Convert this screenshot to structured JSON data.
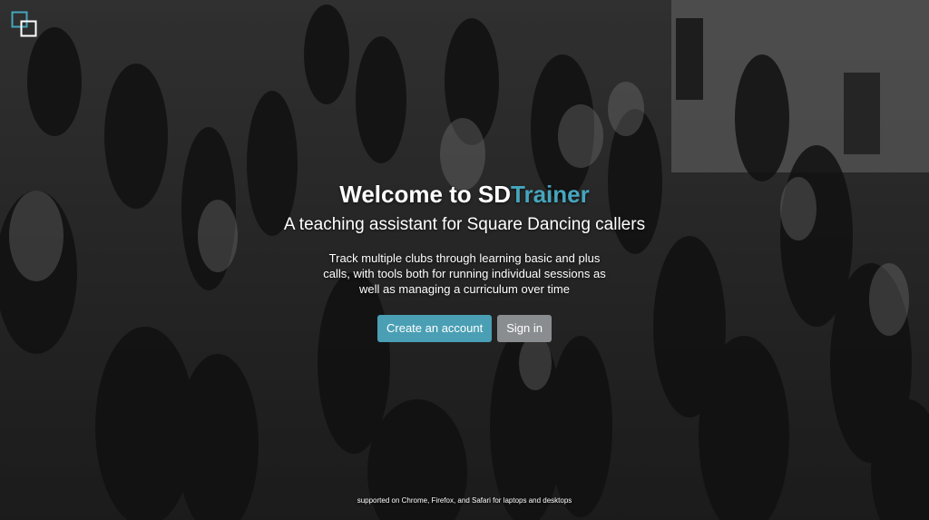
{
  "header": {
    "logo_icon": "overlapping-squares-logo-icon",
    "brand_color": "#46a6bd"
  },
  "hero": {
    "title_prefix": "Welcome to SD",
    "title_accent": "Trainer",
    "subtitle": "A teaching assistant for Square Dancing callers",
    "description": "Track multiple clubs through learning basic and plus calls, with tools both for running individual sessions as well as managing a curriculum over time",
    "create_account_label": "Create an account",
    "sign_in_label": "Sign in",
    "primary_button_color": "#4a9fb4",
    "secondary_button_color": "#8a8d90"
  },
  "footer": {
    "support_text": "supported on Chrome, Firefox, and Safari for laptops and desktops"
  }
}
